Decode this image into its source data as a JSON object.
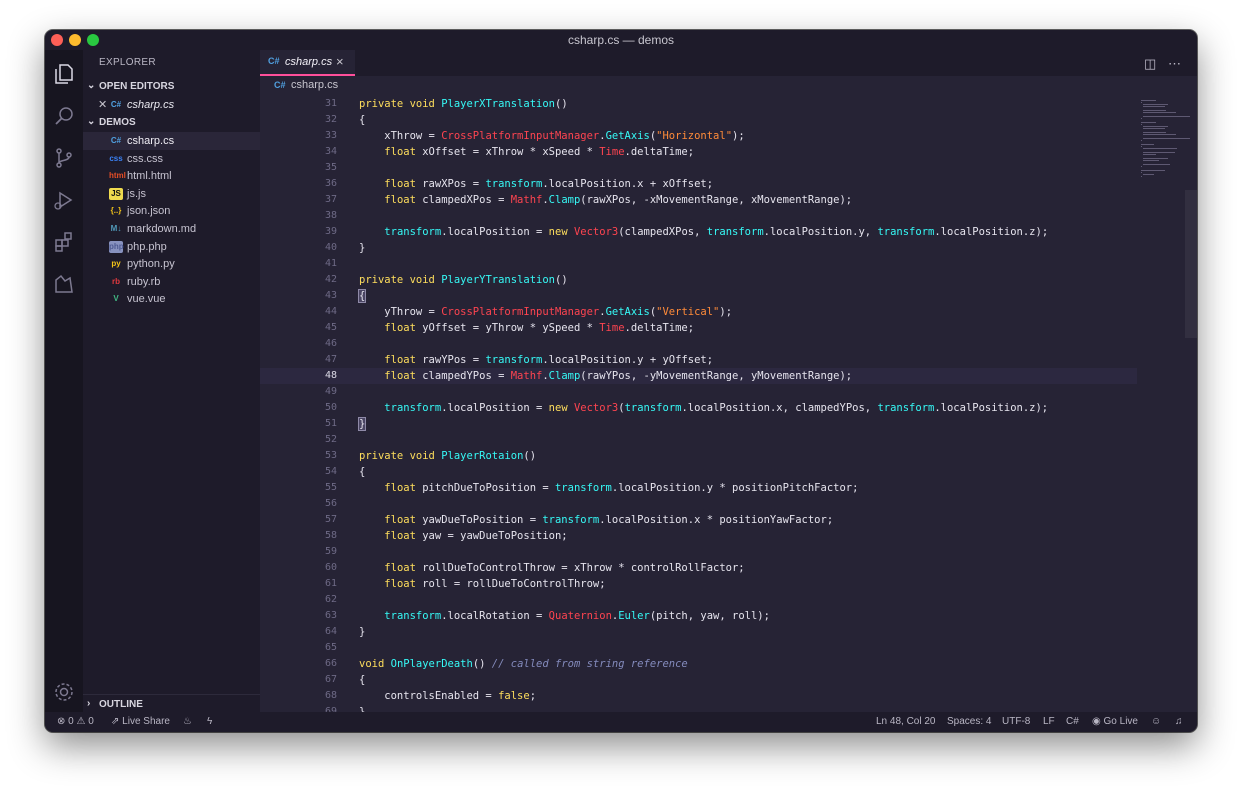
{
  "window": {
    "title": "csharp.cs — demos"
  },
  "sidebar": {
    "title": "EXPLORER",
    "open_editors_label": "OPEN EDITORS",
    "open_editors": [
      {
        "name": "csharp.cs",
        "icon": "C#"
      }
    ],
    "folder_label": "DEMOS",
    "files": [
      {
        "name": "csharp.cs",
        "icon": "C#",
        "active": true
      },
      {
        "name": "css.css",
        "icon": "css"
      },
      {
        "name": "html.html",
        "icon": "html"
      },
      {
        "name": "js.js",
        "icon": "JS"
      },
      {
        "name": "json.json",
        "icon": "{..}"
      },
      {
        "name": "markdown.md",
        "icon": "M↓"
      },
      {
        "name": "php.php",
        "icon": "php"
      },
      {
        "name": "python.py",
        "icon": "py"
      },
      {
        "name": "ruby.rb",
        "icon": "rb"
      },
      {
        "name": "vue.vue",
        "icon": "V"
      }
    ],
    "outline_label": "OUTLINE"
  },
  "tab": {
    "name": "csharp.cs",
    "icon": "C#"
  },
  "breadcrumb": {
    "name": "csharp.cs",
    "icon": "C#"
  },
  "editor": {
    "current_line": 48,
    "lines": [
      {
        "n": 31,
        "text": "    private void PlayerXTranslation()"
      },
      {
        "n": 32,
        "text": "    {"
      },
      {
        "n": 33,
        "text": "        xThrow = CrossPlatformInputManager.GetAxis(\"Horizontal\");"
      },
      {
        "n": 34,
        "text": "        float xOffset = xThrow * xSpeed * Time.deltaTime;"
      },
      {
        "n": 35,
        "text": ""
      },
      {
        "n": 36,
        "text": "        float rawXPos = transform.localPosition.x + xOffset;"
      },
      {
        "n": 37,
        "text": "        float clampedXPos = Mathf.Clamp(rawXPos, -xMovementRange, xMovementRange);"
      },
      {
        "n": 38,
        "text": ""
      },
      {
        "n": 39,
        "text": "        transform.localPosition = new Vector3(clampedXPos, transform.localPosition.y, transform.localPosition.z);"
      },
      {
        "n": 40,
        "text": "    }"
      },
      {
        "n": 41,
        "text": ""
      },
      {
        "n": 42,
        "text": "    private void PlayerYTranslation()"
      },
      {
        "n": 43,
        "text": "    {"
      },
      {
        "n": 44,
        "text": "        yThrow = CrossPlatformInputManager.GetAxis(\"Vertical\");"
      },
      {
        "n": 45,
        "text": "        float yOffset = yThrow * ySpeed * Time.deltaTime;"
      },
      {
        "n": 46,
        "text": ""
      },
      {
        "n": 47,
        "text": "        float rawYPos = transform.localPosition.y + yOffset;"
      },
      {
        "n": 48,
        "text": "        float clampedYPos = Mathf.Clamp(rawYPos, -yMovementRange, yMovementRange);"
      },
      {
        "n": 49,
        "text": ""
      },
      {
        "n": 50,
        "text": "        transform.localPosition = new Vector3(transform.localPosition.x, clampedYPos, transform.localPosition.z);"
      },
      {
        "n": 51,
        "text": "    }"
      },
      {
        "n": 52,
        "text": ""
      },
      {
        "n": 53,
        "text": "    private void PlayerRotaion()"
      },
      {
        "n": 54,
        "text": "    {"
      },
      {
        "n": 55,
        "text": "        float pitchDueToPosition = transform.localPosition.y * positionPitchFactor;"
      },
      {
        "n": 56,
        "text": ""
      },
      {
        "n": 57,
        "text": "        float yawDueToPosition = transform.localPosition.x * positionYawFactor;"
      },
      {
        "n": 58,
        "text": "        float yaw = yawDueToPosition;"
      },
      {
        "n": 59,
        "text": ""
      },
      {
        "n": 60,
        "text": "        float rollDueToControlThrow = xThrow * controlRollFactor;"
      },
      {
        "n": 61,
        "text": "        float roll = rollDueToControlThrow;"
      },
      {
        "n": 62,
        "text": ""
      },
      {
        "n": 63,
        "text": "        transform.localRotation = Quaternion.Euler(pitch, yaw, roll);"
      },
      {
        "n": 64,
        "text": "    }"
      },
      {
        "n": 65,
        "text": ""
      },
      {
        "n": 66,
        "text": "    void OnPlayerDeath() // called from string reference"
      },
      {
        "n": 67,
        "text": "    {"
      },
      {
        "n": 68,
        "text": "        controlsEnabled = false;"
      },
      {
        "n": 69,
        "text": "    }"
      }
    ]
  },
  "status": {
    "errors": "0",
    "warnings": "0",
    "live_share": "Live Share",
    "position": "Ln 48, Col 20",
    "spaces": "Spaces: 4",
    "encoding": "UTF-8",
    "eol": "LF",
    "language": "C#",
    "go_live": "Go Live"
  },
  "colors": {
    "background": "#262335",
    "sidebar": "#1e1b2a",
    "activity_bar": "#171520",
    "tab_accent": "#ff4f9b",
    "keyword": "#fede5d",
    "function": "#36f9f6",
    "class": "#fe4450",
    "string": "#ff8b39",
    "comment": "#848bbd"
  }
}
